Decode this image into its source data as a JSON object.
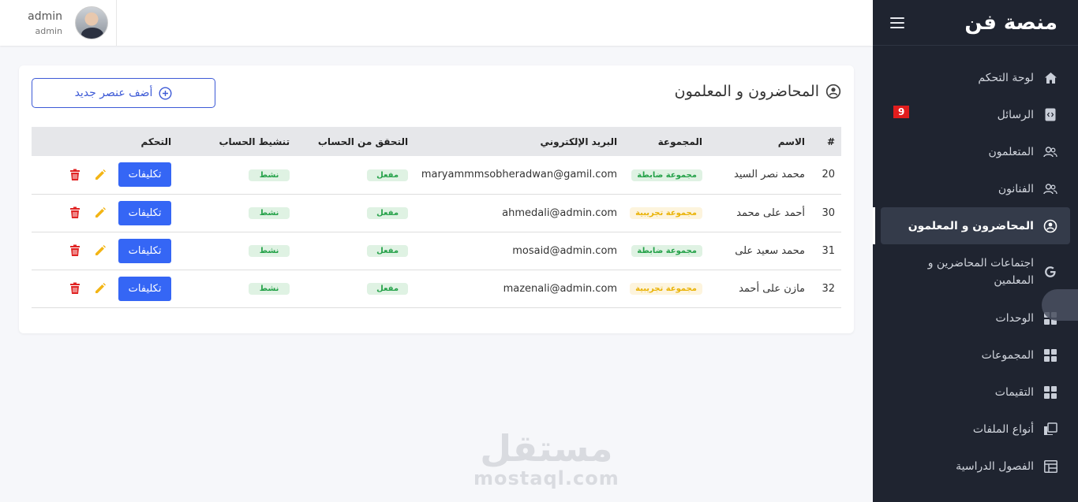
{
  "brand": {
    "title": "منصة فن"
  },
  "user": {
    "name": "admin",
    "role": "admin"
  },
  "sidebar": {
    "items": [
      {
        "label": "لوحة التحكم",
        "icon": "home-icon"
      },
      {
        "label": "الرسائل",
        "icon": "code-file-icon",
        "badge": "9"
      },
      {
        "label": "المتعلمون",
        "icon": "users-icon"
      },
      {
        "label": "الفنانون",
        "icon": "users-icon"
      },
      {
        "label": "المحاضرون و المعلمون",
        "icon": "lecturer-icon",
        "active": true
      },
      {
        "label": "اجتماعات المحاضرين و المعلمين",
        "icon": "google-icon"
      },
      {
        "label": "الوحدات",
        "icon": "grid-icon"
      },
      {
        "label": "المجموعات",
        "icon": "grid-icon"
      },
      {
        "label": "التقيمات",
        "icon": "grid-icon"
      },
      {
        "label": "أنواع الملفات",
        "icon": "copy-icon"
      },
      {
        "label": "الفصول الدراسية",
        "icon": "table-icon"
      }
    ]
  },
  "page": {
    "title": "المحاضرون و المعلمون",
    "add_label": "أضف عنصر جديد"
  },
  "table": {
    "headers": [
      "#",
      "الاسم",
      "المجموعة",
      "البريد الإلكتروني",
      "التحقق من الحساب",
      "تنشيط الحساب",
      "التحكم"
    ],
    "rows": [
      {
        "id": "20",
        "name": "محمد نصر السيد",
        "group": "مجموعة ضابطة",
        "group_color": "green",
        "email": "maryammmsobheradwan@gamil.com",
        "verified": "مفعل",
        "active": "نشط"
      },
      {
        "id": "30",
        "name": "أحمد على محمد",
        "group": "مجموعة تجريبية",
        "group_color": "yellow",
        "email": "ahmedali@admin.com",
        "verified": "مفعل",
        "active": "نشط"
      },
      {
        "id": "31",
        "name": "محمد سعيد على",
        "group": "مجموعة ضابطة",
        "group_color": "green",
        "email": "mosaid@admin.com",
        "verified": "مفعل",
        "active": "نشط"
      },
      {
        "id": "32",
        "name": "مازن على أحمد",
        "group": "مجموعة تجريبية",
        "group_color": "yellow",
        "email": "mazenali@admin.com",
        "verified": "مفعل",
        "active": "نشط"
      }
    ],
    "assign_label": "تكليفات"
  },
  "watermark": {
    "arabic": "مستقل",
    "latin": "mostaql.com"
  },
  "colors": {
    "sidebar_bg": "#1f2430",
    "primary": "#3566f5",
    "edit": "#f3b515",
    "delete": "#e02424",
    "badge": "#e11d1d"
  }
}
